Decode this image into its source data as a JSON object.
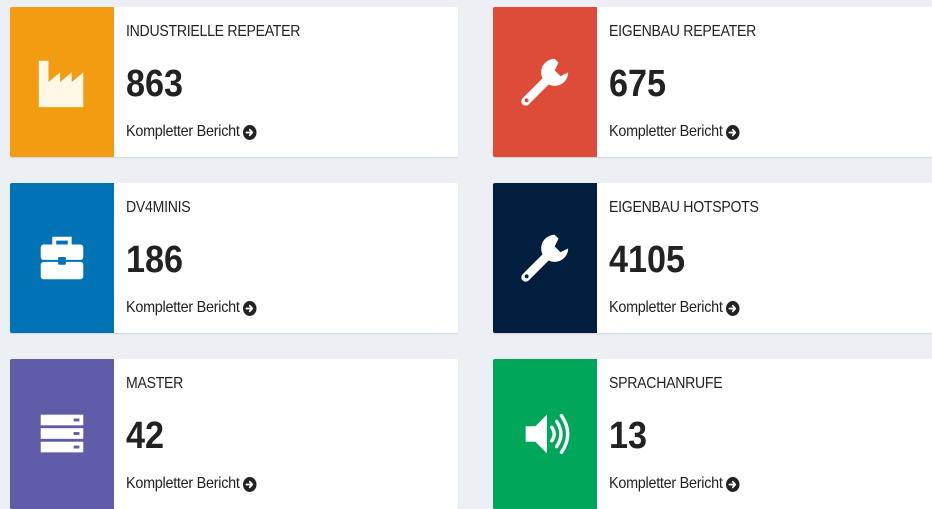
{
  "link_label": "Kompletter Bericht",
  "cards": [
    {
      "title": "INDUSTRIELLE REPEATER",
      "value": "863",
      "color": "#f39c12",
      "icon": "factory-icon"
    },
    {
      "title": "EIGENBAU REPEATER",
      "value": "675",
      "color": "#dd4b39",
      "icon": "wrench-icon"
    },
    {
      "title": "DV4MINIS",
      "value": "186",
      "color": "#0073b7",
      "icon": "briefcase-icon"
    },
    {
      "title": "EIGENBAU HOTSPOTS",
      "value": "4105",
      "color": "#001f3f",
      "icon": "wrench-icon"
    },
    {
      "title": "MASTER",
      "value": "42",
      "color": "#605ca8",
      "icon": "server-icon"
    },
    {
      "title": "SPRACHANRUFE",
      "value": "13",
      "color": "#00a65a",
      "icon": "volume-icon"
    }
  ]
}
